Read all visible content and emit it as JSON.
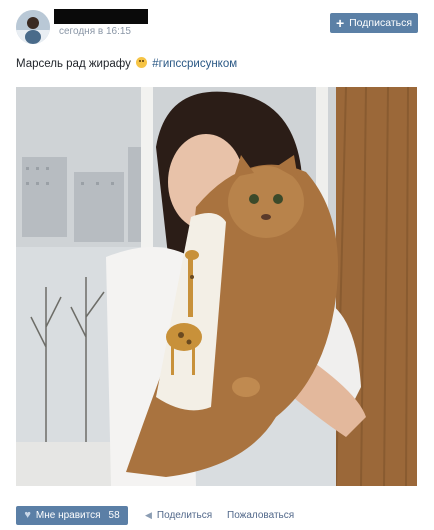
{
  "header": {
    "time": "сегодня в 16:15",
    "subscribe_label": "Подписаться"
  },
  "post": {
    "text": "Марсель рад жирафу",
    "hashtag": "#гипссрисунком"
  },
  "footer": {
    "like_label": "Мне нравится",
    "like_count": "58",
    "share_label": "Поделиться",
    "report_label": "Пожаловаться"
  },
  "colors": {
    "accent": "#5b80a6",
    "link": "#2a5885",
    "muted": "#8a96a6"
  },
  "icons": [
    "plus-icon",
    "emoji-icon",
    "heart-icon",
    "megaphone-icon"
  ]
}
